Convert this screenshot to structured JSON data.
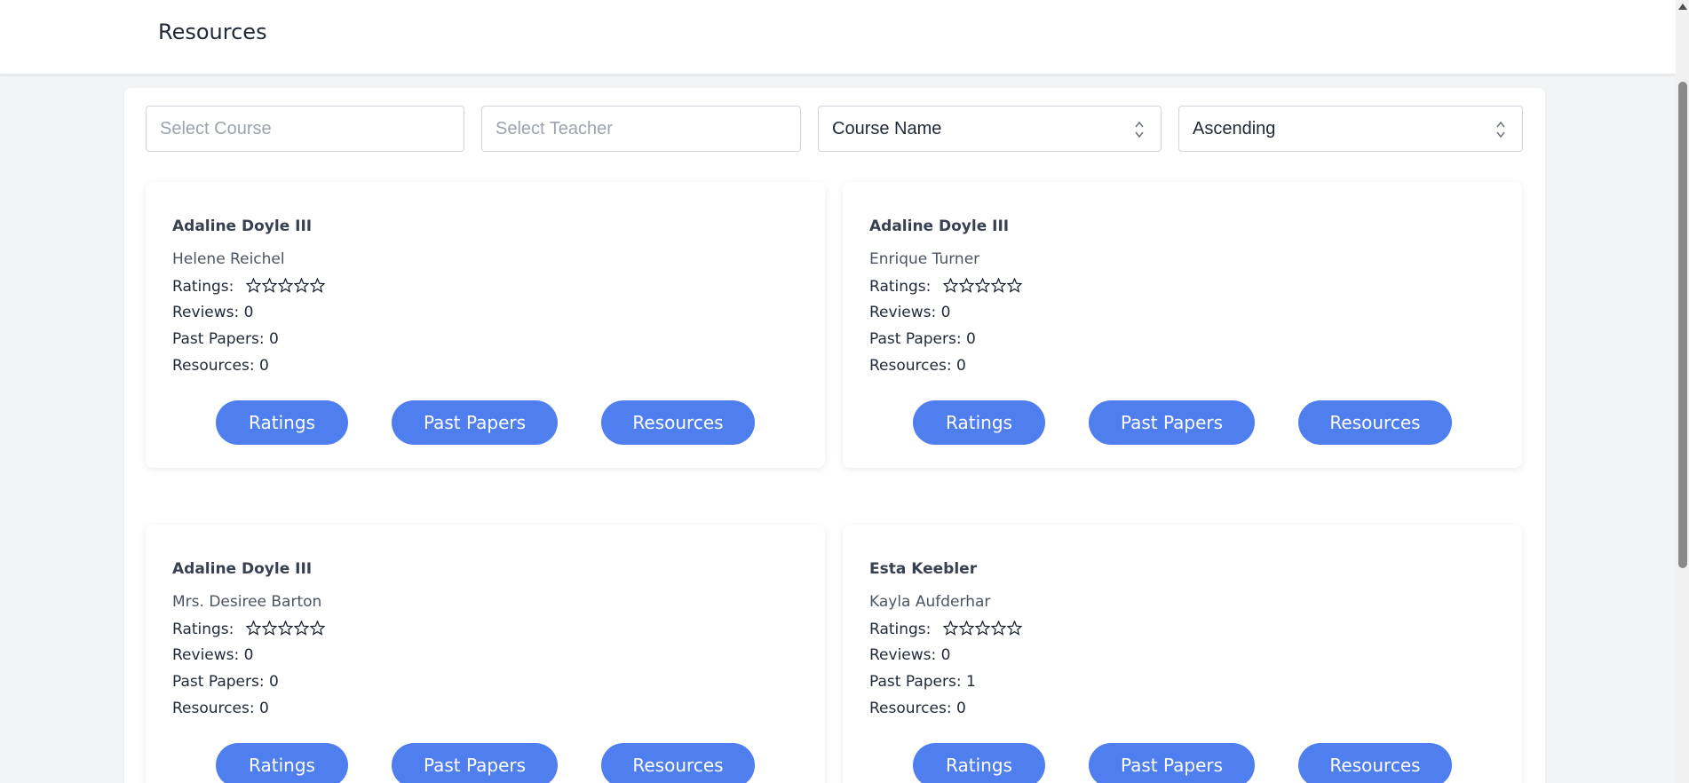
{
  "header": {
    "title": "Resources"
  },
  "filters": {
    "course_placeholder": "Select Course",
    "teacher_placeholder": "Select Teacher",
    "sort_field": "Course Name",
    "sort_order": "Ascending"
  },
  "labels": {
    "ratings": "Ratings:",
    "btn_ratings": "Ratings",
    "btn_past_papers": "Past Papers",
    "btn_resources": "Resources"
  },
  "cards": [
    {
      "course": "Adaline Doyle III",
      "teacher": "Helene Reichel",
      "reviews": "Reviews: 0",
      "past_papers": "Past Papers: 0",
      "resources": "Resources: 0",
      "rating_stars": 0
    },
    {
      "course": "Adaline Doyle III",
      "teacher": "Enrique Turner",
      "reviews": "Reviews: 0",
      "past_papers": "Past Papers: 0",
      "resources": "Resources: 0",
      "rating_stars": 0
    },
    {
      "course": "Adaline Doyle III",
      "teacher": "Mrs. Desiree Barton",
      "reviews": "Reviews: 0",
      "past_papers": "Past Papers: 0",
      "resources": "Resources: 0",
      "rating_stars": 0
    },
    {
      "course": "Esta Keebler",
      "teacher": "Kayla Aufderhar",
      "reviews": "Reviews: 0",
      "past_papers": "Past Papers: 1",
      "resources": "Resources: 0",
      "rating_stars": 0
    }
  ],
  "colors": {
    "accent": "#4f7fef",
    "background": "#f3f4f6"
  }
}
